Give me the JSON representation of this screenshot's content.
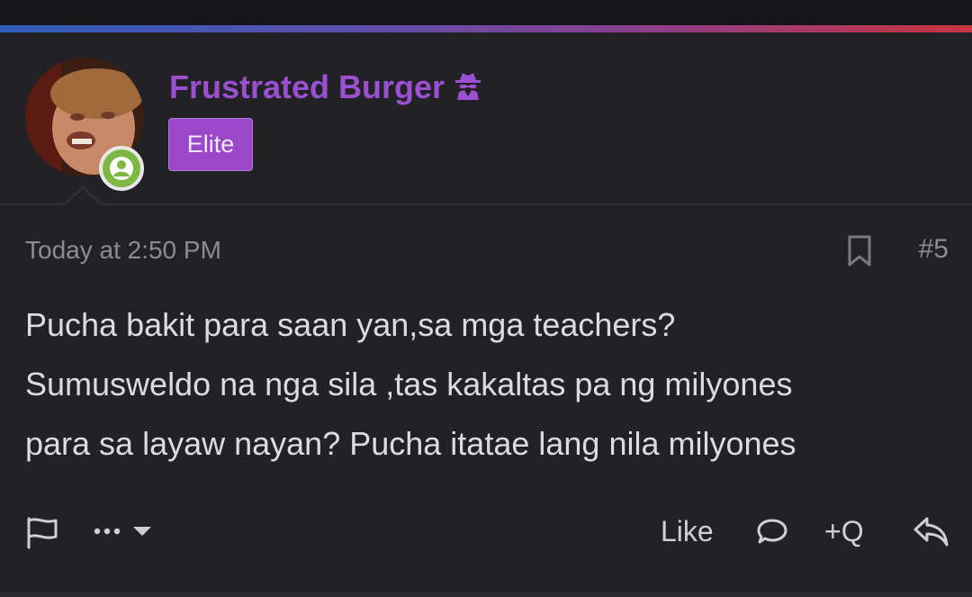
{
  "post": {
    "author": {
      "name": "Frustrated Burger",
      "role": "Elite",
      "name_icon": "spy-icon",
      "status_icon": "user-online-icon"
    },
    "timestamp": "Today at 2:50 PM",
    "post_number": "#5",
    "message_lines": [
      "Pucha bakit para saan yan,sa mga teachers?",
      "Sumusweldo na nga sila ,tas kakaltas pa ng milyones",
      "para sa layaw nayan? Pucha itatae lang nila milyones"
    ],
    "actions": {
      "report_icon": "flag-icon",
      "more_icon": "ellipsis-icon",
      "like_label": "Like",
      "comment_icon": "speech-bubble-icon",
      "quote_label": "+Q",
      "reply_icon": "reply-icon"
    }
  },
  "colors": {
    "background": "#222226",
    "username": "#9b4fd1",
    "role_badge": "#9a48c9",
    "online": "#7db842",
    "text": "#dcdce0",
    "muted": "#8b8b92"
  }
}
